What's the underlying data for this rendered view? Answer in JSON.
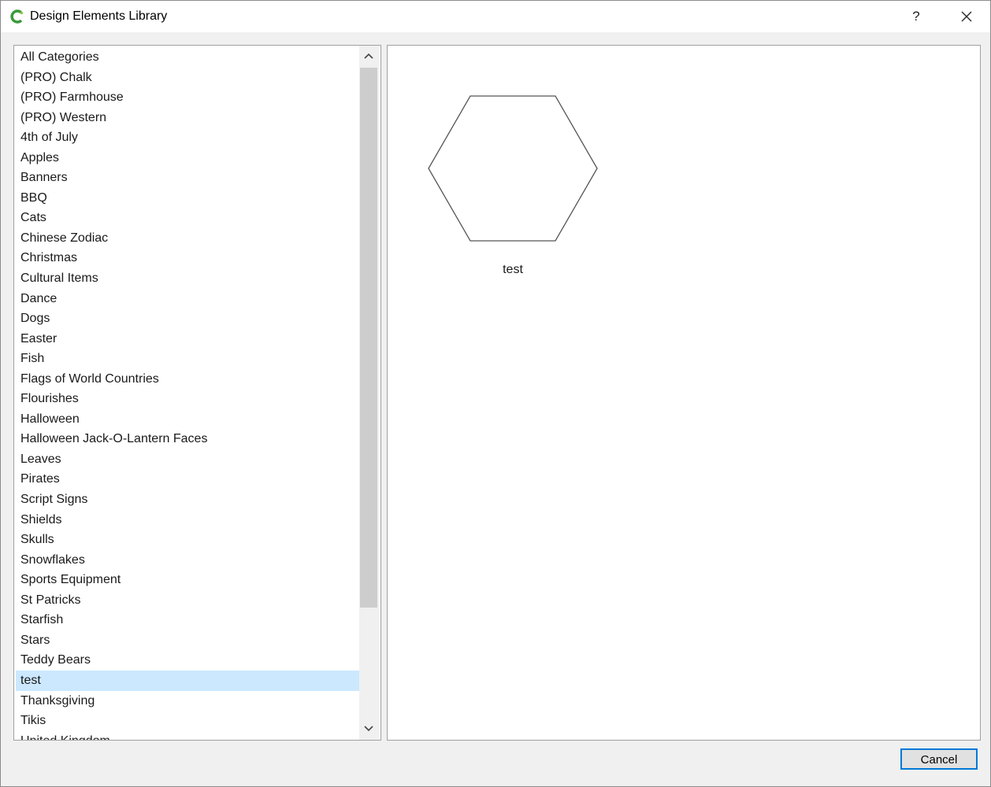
{
  "window": {
    "title": "Design Elements Library",
    "help_label": "?",
    "accent_color": "#0078d7",
    "selection_color": "#cce8ff",
    "app_icon_color": "#4caf50"
  },
  "category_list": {
    "selected": "test",
    "items": [
      "All Categories",
      "(PRO) Chalk",
      "(PRO) Farmhouse",
      "(PRO) Western",
      "4th of July",
      "Apples",
      "Banners",
      "BBQ",
      "Cats",
      "Chinese Zodiac",
      "Christmas",
      "Cultural Items",
      "Dance",
      "Dogs",
      "Easter",
      "Fish",
      "Flags of World Countries",
      "Flourishes",
      "Halloween",
      "Halloween Jack-O-Lantern Faces",
      "Leaves",
      "Pirates",
      "Script Signs",
      "Shields",
      "Skulls",
      "Snowflakes",
      "Sports Equipment",
      "St Patricks",
      "Starfish",
      "Stars",
      "Teddy Bears",
      "test",
      "Thanksgiving",
      "Tikis",
      "United Kingdom"
    ]
  },
  "preview": {
    "elements": [
      {
        "label": "test",
        "shape_icon": "hexagon-icon"
      }
    ]
  },
  "footer": {
    "cancel_label": "Cancel"
  }
}
